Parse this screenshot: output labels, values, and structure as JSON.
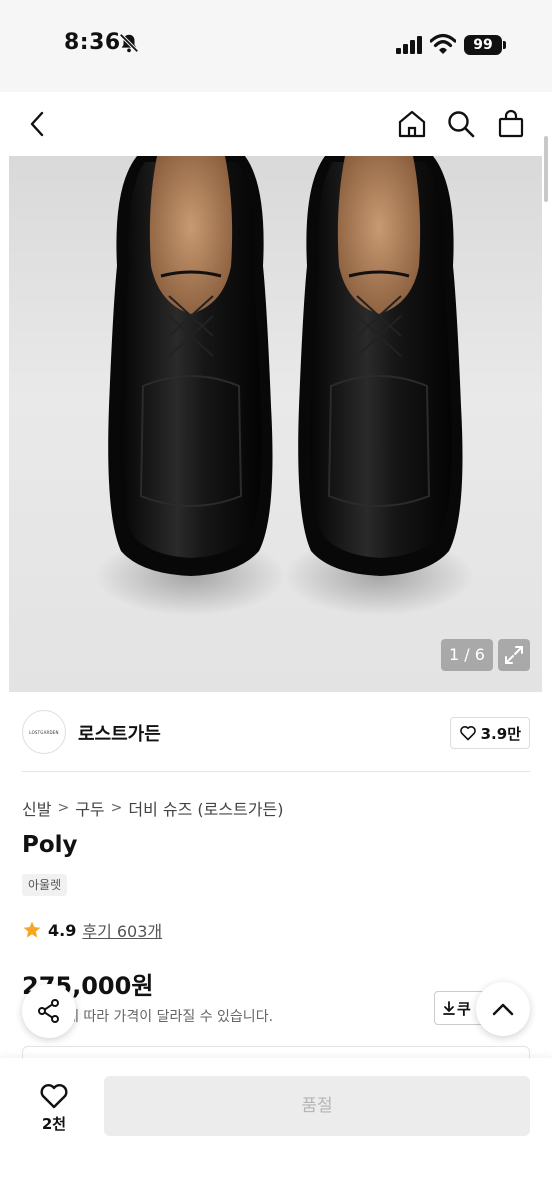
{
  "status_bar": {
    "time": "8:36",
    "battery": "99"
  },
  "gallery": {
    "counter": "1 / 6"
  },
  "brand": {
    "logo_text": "LOSTGARDEN",
    "name": "로스트가든",
    "likes": "3.9만"
  },
  "breadcrumb": [
    "신발",
    "구두",
    "더비 슈즈 (로스트가든)"
  ],
  "product": {
    "title": "Poly",
    "tag": "아울렛",
    "rating": "4.9",
    "reviews": "후기 603개",
    "price": "275,000원",
    "price_note": "에 따라 가격이 달라질 수 있습니다.",
    "coupon_label": "쿠"
  },
  "bottom": {
    "wish_count": "2천",
    "soldout_label": "품절"
  },
  "colors": {
    "accent_star": "#f5a623",
    "soldout_bg": "#ececec"
  }
}
